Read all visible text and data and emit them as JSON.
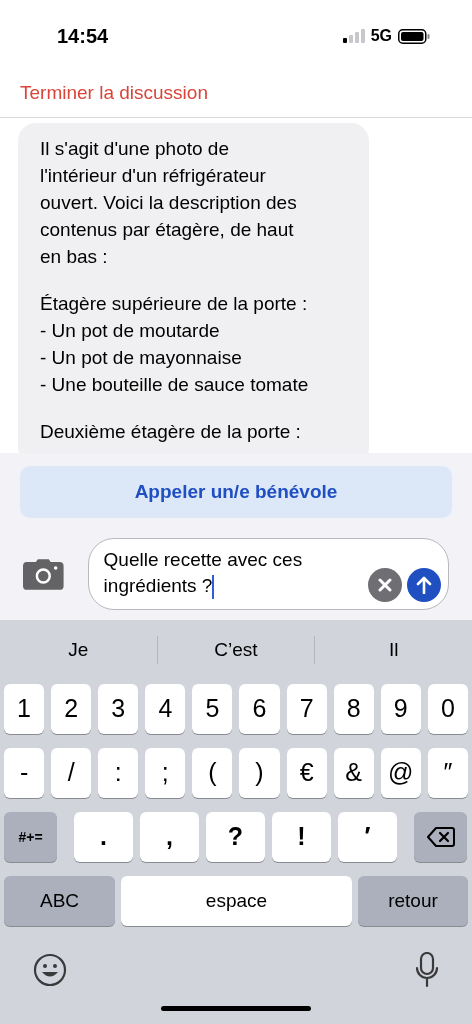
{
  "status_bar": {
    "time": "14:54",
    "network": "5G"
  },
  "header": {
    "end_button": "Terminer la discussion"
  },
  "messages": [
    {
      "paragraphs": [
        [
          "Il s'agit d'une photo de",
          "l'intérieur d'un réfrigérateur",
          "ouvert. Voici la description des",
          "contenus par étagère, de haut",
          "en bas :"
        ],
        [
          "Étagère supérieure de la porte :",
          "- Un pot de moutarde",
          "- Un pot de mayonnaise",
          "- Une bouteille de sauce tomate"
        ],
        [
          "Deuxième étagère de la porte :"
        ]
      ]
    }
  ],
  "call_button": "Appeler un/e bénévole",
  "composer": {
    "value": "Quelle recette avec ces ingrédients ?"
  },
  "keyboard": {
    "suggestions": [
      "Je",
      "C’est",
      "Il"
    ],
    "rows": [
      [
        {
          "kind": "char",
          "label": "1"
        },
        {
          "kind": "char",
          "label": "2"
        },
        {
          "kind": "char",
          "label": "3"
        },
        {
          "kind": "char",
          "label": "4"
        },
        {
          "kind": "char",
          "label": "5"
        },
        {
          "kind": "char",
          "label": "6"
        },
        {
          "kind": "char",
          "label": "7"
        },
        {
          "kind": "char",
          "label": "8"
        },
        {
          "kind": "char",
          "label": "9"
        },
        {
          "kind": "char",
          "label": "0"
        }
      ],
      [
        {
          "kind": "char",
          "label": "-"
        },
        {
          "kind": "char",
          "label": "/"
        },
        {
          "kind": "char",
          "label": ":"
        },
        {
          "kind": "char",
          "label": ";"
        },
        {
          "kind": "char",
          "label": "("
        },
        {
          "kind": "char",
          "label": ")"
        },
        {
          "kind": "char",
          "label": "€"
        },
        {
          "kind": "char",
          "label": "&"
        },
        {
          "kind": "char",
          "label": "@"
        },
        {
          "kind": "char",
          "label": "″"
        }
      ],
      [
        {
          "kind": "mode",
          "label": "#+="
        },
        {
          "kind": "wide",
          "label": "."
        },
        {
          "kind": "wide",
          "label": ","
        },
        {
          "kind": "wide",
          "label": "?"
        },
        {
          "kind": "wide",
          "label": "!"
        },
        {
          "kind": "wide",
          "label": "′"
        },
        {
          "kind": "delete"
        }
      ]
    ],
    "bottom_row": [
      {
        "kind": "abc",
        "label": "ABC"
      },
      {
        "kind": "space",
        "label": "espace"
      },
      {
        "kind": "return",
        "label": "retour"
      }
    ]
  }
}
